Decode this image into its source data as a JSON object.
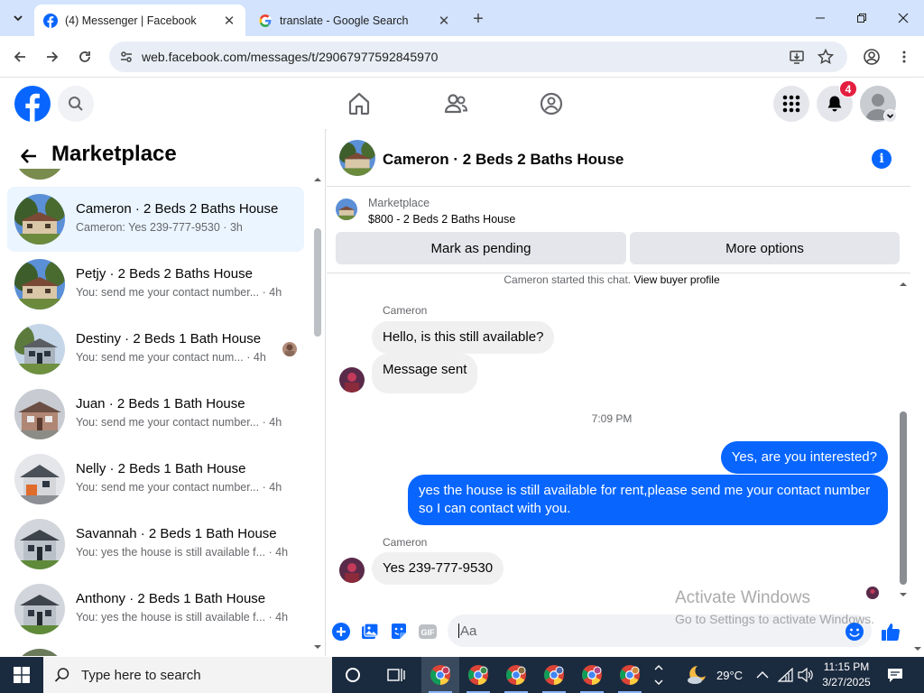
{
  "browser": {
    "tabs": [
      {
        "title": "(4) Messenger | Facebook",
        "active": true
      },
      {
        "title": "translate - Google Search",
        "active": false
      }
    ],
    "url": "web.facebook.com/messages/t/29067977592845970"
  },
  "facebook": {
    "notification_count": "4"
  },
  "marketplace": {
    "title": "Marketplace",
    "conversations": [
      {
        "title": "Cameron · 2 Beds 2 Baths House",
        "preview": "Cameron: Yes 239-777-9530 · 3h",
        "active": true
      },
      {
        "title": "Petjy · 2 Beds 2 Baths House",
        "preview": "You: send me your contact number... · 4h"
      },
      {
        "title": "Destiny · 2 Beds 1 Bath House",
        "preview": "You: send me your contact num... · 4h"
      },
      {
        "title": "Juan · 2 Beds 1 Bath House",
        "preview": "You: send me your contact number... · 4h"
      },
      {
        "title": "Nelly · 2 Beds 1 Bath House",
        "preview": "You: send me your contact number... · 4h"
      },
      {
        "title": "Savannah · 2 Beds 1 Bath House",
        "preview": "You: yes the house is still available f... · 4h"
      },
      {
        "title": "Anthony · 2 Beds 1 Bath House",
        "preview": "You: yes the house is still available f... · 4h"
      }
    ]
  },
  "chat": {
    "title": "Cameron · 2 Beds 2 Baths House",
    "listing_source": "Marketplace",
    "listing_price": "$800 - 2 Beds 2 Baths House",
    "btn_pending": "Mark as pending",
    "btn_more": "More options",
    "system_prefix": "Cameron started this chat.",
    "system_link": "View buyer profile",
    "sender_name": "Cameron",
    "messages": [
      "Hello, is this still available?",
      "Message sent",
      "Yes, are you interested?",
      "yes the house is still available for rent,please send me your contact number so I can contact with you.",
      "Yes 239-777-9530"
    ],
    "timestamp": "7:09 PM",
    "composer_placeholder": "Aa"
  },
  "watermark": {
    "line1": "Activate Windows",
    "line2": "Go to Settings to activate Windows."
  },
  "taskbar": {
    "search_placeholder": "Type here to search",
    "weather": "29°C",
    "time": "11:15 PM",
    "date": "3/27/2025"
  },
  "colors": {
    "accent": "#0866ff",
    "badge": "#e41e3f",
    "active_conversation": "#ebf5ff"
  }
}
